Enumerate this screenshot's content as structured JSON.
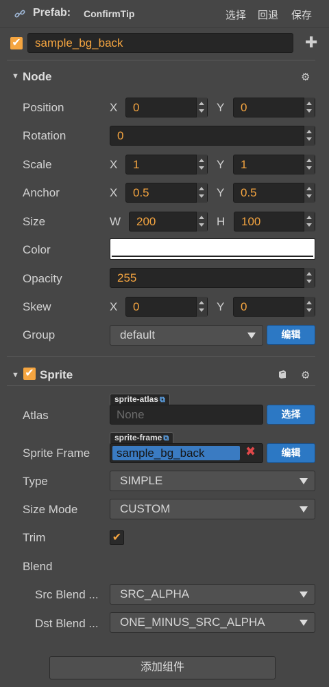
{
  "header": {
    "icon": "link-icon",
    "prefab_label": "Prefab:",
    "prefab_name": "ConfirmTip",
    "actions": [
      "选择",
      "回退",
      "保存"
    ]
  },
  "node_name": {
    "enabled": true,
    "value": "sample_bg_back",
    "add_icon": "plus-icon"
  },
  "node": {
    "title": "Node",
    "position": {
      "label": "Position",
      "x_label": "X",
      "x": "0",
      "y_label": "Y",
      "y": "0"
    },
    "rotation": {
      "label": "Rotation",
      "value": "0"
    },
    "scale": {
      "label": "Scale",
      "x_label": "X",
      "x": "1",
      "y_label": "Y",
      "y": "1"
    },
    "anchor": {
      "label": "Anchor",
      "x_label": "X",
      "x": "0.5",
      "y_label": "Y",
      "y": "0.5"
    },
    "size": {
      "label": "Size",
      "w_label": "W",
      "w": "200",
      "h_label": "H",
      "h": "100"
    },
    "color": {
      "label": "Color",
      "value": "#ffffff"
    },
    "opacity": {
      "label": "Opacity",
      "value": "255"
    },
    "skew": {
      "label": "Skew",
      "x_label": "X",
      "x": "0",
      "y_label": "Y",
      "y": "0"
    },
    "group": {
      "label": "Group",
      "value": "default",
      "edit_button": "编辑"
    }
  },
  "sprite": {
    "title": "Sprite",
    "enabled": true,
    "atlas": {
      "label": "Atlas",
      "tag": "sprite-atlas",
      "value": "None",
      "button": "选择"
    },
    "sprite_frame": {
      "label": "Sprite Frame",
      "tag": "sprite-frame",
      "value": "sample_bg_back",
      "button": "编辑"
    },
    "type": {
      "label": "Type",
      "value": "SIMPLE"
    },
    "size_mode": {
      "label": "Size Mode",
      "value": "CUSTOM"
    },
    "trim": {
      "label": "Trim",
      "checked": true
    },
    "blend": {
      "label": "Blend"
    },
    "src_blend": {
      "label": "Src Blend ...",
      "value": "SRC_ALPHA"
    },
    "dst_blend": {
      "label": "Dst Blend ...",
      "value": "ONE_MINUS_SRC_ALPHA"
    }
  },
  "footer": {
    "add_component": "添加组件"
  },
  "colors": {
    "accent": "#f5a540",
    "primary_button": "#2c78c4",
    "background": "#464646",
    "field": "#262626"
  }
}
